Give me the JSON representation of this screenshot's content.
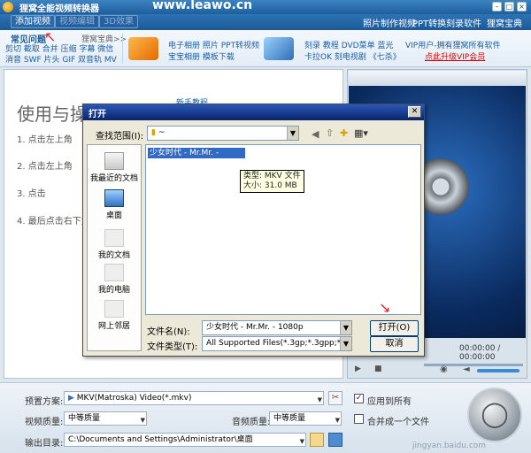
{
  "window": {
    "title": "狸窝全能视频转换器",
    "watermark": "www.leawo.cn"
  },
  "toolbar": {
    "add_video": "添加视频",
    "video_edit": "视频编辑",
    "effect": "3D效果",
    "links": [
      "照片制作视频",
      "PPT转换",
      "刻录软件",
      "狸窝宝典"
    ]
  },
  "ads": {
    "tab_label": "常见问题",
    "tab_more": "狸窝宝典>>",
    "line1": "剪切 截取 合并 压缩 字幕 微信",
    "line2": "消音 SWF 片头 GIF 双音轨 MV",
    "mid1_line1": "电子相册 照片 PPT转视频",
    "mid1_line2": "宝宝相册 模板下载",
    "mid2_line1": "刻录 教程 DVD菜单 蓝光",
    "mid2_line2": "卡拉OK 刻电视剧 《七杀》",
    "vip_line1": "VIP用户-拥有狸窝所有软件",
    "vip_line2": "点此升级VIP会员"
  },
  "guide": {
    "title": "使用与操作向导：",
    "link": "新手教程",
    "step1": "1. 点击左上角",
    "step2": "2. 点击左上角",
    "step3": "3. 点击",
    "step4": "4. 最后点击右下角"
  },
  "preview": {
    "time": "00:00:00 / 00:00:00"
  },
  "dialog": {
    "title": "打开",
    "look_in_label": "查找范围(I):",
    "look_in_value": "~",
    "places": [
      "我最近的文档",
      "桌面",
      "我的文档",
      "我的电脑",
      "网上邻居"
    ],
    "file_item": "少女时代 - Mr.Mr. - 1080p",
    "tooltip_type": "类型: MKV 文件",
    "tooltip_size": "大小: 31.0 MB",
    "filename_label": "文件名(N):",
    "filename_value": "少女时代 - Mr.Mr. - 1080p",
    "filetype_label": "文件类型(T):",
    "filetype_value": "All Supported Files(*.3gp;*.3gpp;*.3g",
    "open_button": "打开(O)",
    "cancel_button": "取消"
  },
  "settings": {
    "preset_label": "预置方案:",
    "preset_value": "MKV(Matroska) Video(*.mkv)",
    "apply_all": "应用到所有",
    "video_quality_label": "视频质量:",
    "video_quality_value": "中等质量",
    "audio_quality_label": "音频质量:",
    "audio_quality_value": "中等质量",
    "merge_label": "合并成一个文件",
    "output_label": "输出目录:",
    "output_value": "C:\\Documents and Settings\\Administrator\\桌面",
    "baidu_watermark": "jingyan.baidu.com"
  },
  "colors": {
    "accent": "#1f5e9c",
    "title_bar": "#0a246a",
    "dialog_bg": "#ece9d8"
  }
}
